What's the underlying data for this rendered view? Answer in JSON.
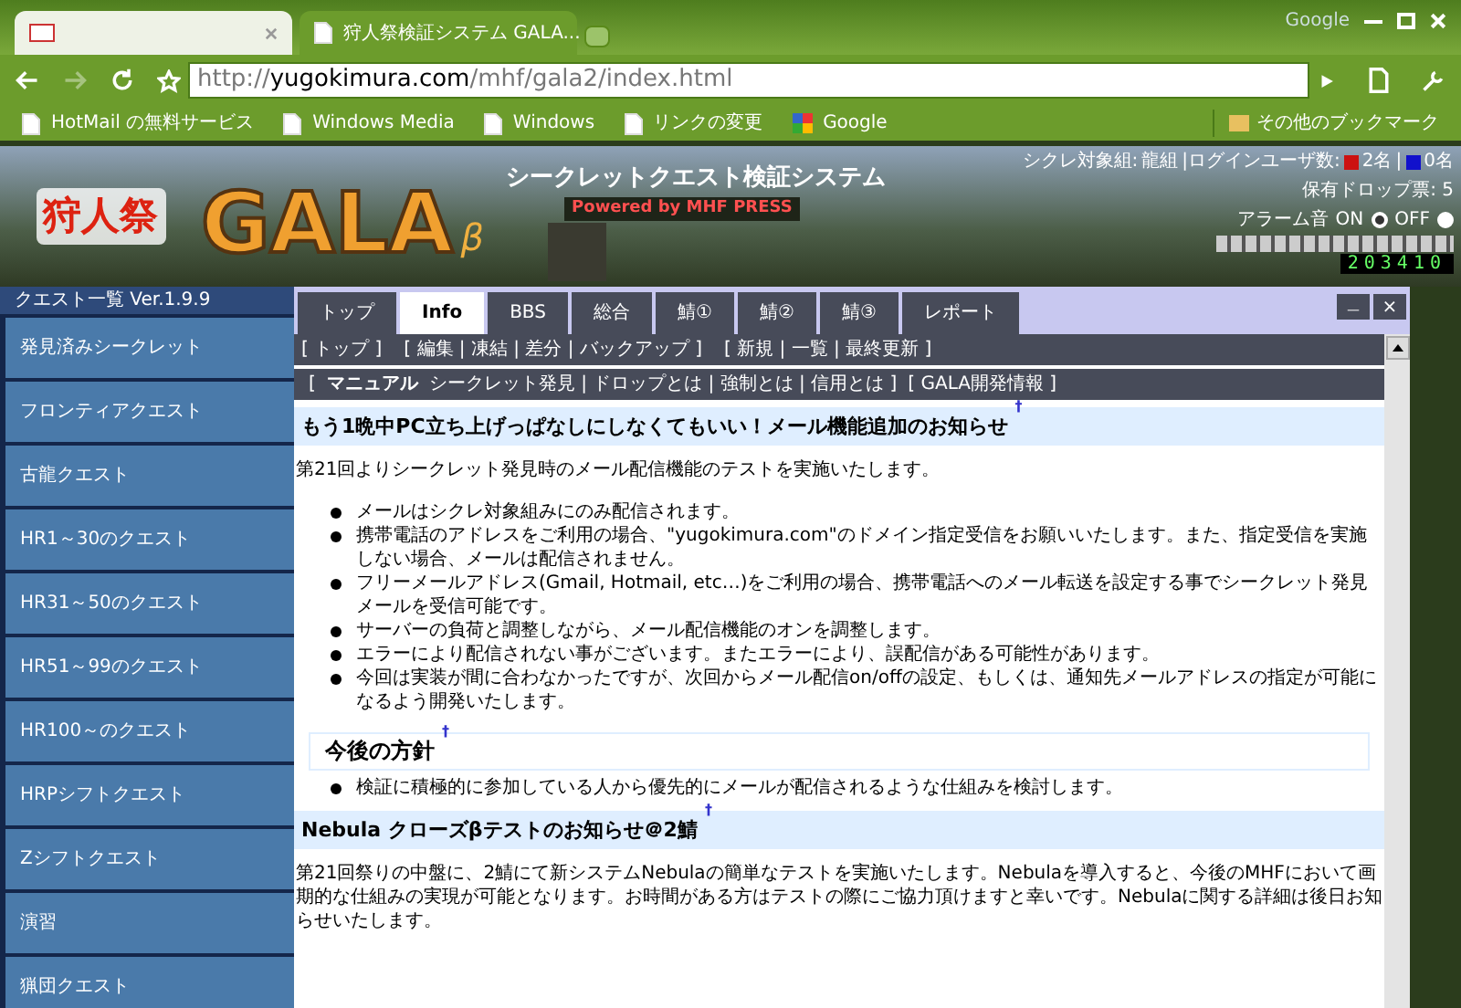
{
  "browser": {
    "tabs": [
      {
        "kind": "mail",
        "selected": false
      },
      {
        "title": "狩人祭検証システム GALA...",
        "kind": "page",
        "selected": true
      }
    ],
    "corner_label": "Google",
    "url": {
      "host": "yugokimura.com",
      "prefix": "http://",
      "path": "/mhf/gala2/index.html"
    },
    "bookmarks": [
      {
        "label": "HotMail の無料サービス",
        "kind": "page"
      },
      {
        "label": "Windows Media",
        "kind": "page"
      },
      {
        "label": "Windows",
        "kind": "page"
      },
      {
        "label": "リンクの変更",
        "kind": "page"
      },
      {
        "label": "Google",
        "kind": "google"
      }
    ],
    "other_bookmarks": "その他のブックマーク"
  },
  "banner": {
    "festival": "狩人祭",
    "logo": "GALA",
    "beta": "β",
    "subtitle": "シークレットクエスト検証システム",
    "powered": "Powered by MHF PRESS",
    "status": {
      "target_label": "シクレ対象組:",
      "target": "龍組",
      "users_label": "|ログインユーザ数:",
      "red_count": "2名",
      "separator": "|",
      "blue_count": "0名",
      "drops": "保有ドロップ票: 5"
    },
    "alarm": {
      "label": "アラーム音",
      "options": [
        {
          "label": "ON",
          "selected": true
        },
        {
          "label": "OFF",
          "selected": false
        }
      ]
    },
    "counter": "203410"
  },
  "sidebar": {
    "title": "クエスト一覧 Ver.1.9.9",
    "items": [
      "発見済みシークレット",
      "フロンティアクエスト",
      "古龍クエスト",
      "HR1～30のクエスト",
      "HR31～50のクエスト",
      "HR51～99のクエスト",
      "HR100～のクエスト",
      "HRPシフトクエスト",
      "Zシフトクエスト",
      "演習",
      "猟団クエスト"
    ]
  },
  "panel": {
    "tabs": [
      {
        "label": "トップ",
        "selected": false
      },
      {
        "label": "Info",
        "selected": true
      },
      {
        "label": "BBS",
        "selected": false
      },
      {
        "label": "総合",
        "selected": false
      },
      {
        "label": "鯖①",
        "selected": false
      },
      {
        "label": "鯖②",
        "selected": false
      },
      {
        "label": "鯖③",
        "selected": false
      },
      {
        "label": "レポート",
        "selected": false
      }
    ],
    "minimize": "＿",
    "close": "×",
    "menu": [
      "[ トップ ]",
      "[ 編集 | 凍結 | 差分 | バックアップ ]",
      "[ 新規 | 一覧 | 最終更新 ]"
    ],
    "submenu": [
      {
        "text": "[",
        "bold": false
      },
      {
        "text": "マニュアル",
        "bold": true
      },
      {
        "text": "シークレット発見 | ドロップとは | 強制とは | 信用とは ]",
        "bold": false
      },
      {
        "text": "[ GALA開発情報 ]",
        "bold": false
      }
    ],
    "content": [
      {
        "kind": "h3",
        "text": "もう1晩中PC立ち上げっぱなしにしなくてもいい！メール機能追加のお知らせ",
        "mark": "†"
      },
      {
        "kind": "p",
        "text": "第21回よりシークレット発見時のメール配信機能のテストを実施いたします。"
      },
      {
        "kind": "ul",
        "items": [
          "メールはシクレ対象組みにのみ配信されます。",
          "携帯電話のアドレスをご利用の場合、\"yugokimura.com\"のドメイン指定受信をお願いいたします。また、指定受信を実施しない場合、メールは配信されません。",
          "フリーメールアドレス(Gmail, Hotmail, etc…)をご利用の場合、携帯電話へのメール転送を設定する事でシークレット発見メールを受信可能です。",
          "サーバーの負荷と調整しながら、メール配信機能のオンを調整します。",
          "エラーにより配信されない事がございます。またエラーにより、誤配信がある可能性があります。",
          "今回は実装が間に合わなかったですが、次回からメール配信on/offの設定、もしくは、通知先メールアドレスの指定が可能になるよう開発いたします。"
        ]
      },
      {
        "kind": "h4",
        "text": "今後の方針",
        "mark": "†"
      },
      {
        "kind": "ul",
        "items": [
          "検証に積極的に参加している人から優先的にメールが配信されるような仕組みを検討します。"
        ]
      },
      {
        "kind": "h3",
        "text": "Nebula クローズβテストのお知らせ＠2鯖",
        "mark": "†"
      },
      {
        "kind": "p",
        "text": "第21回祭りの中盤に、2鯖にて新システムNebulaの簡単なテストを実施いたします。Nebulaを導入すると、今後のMHFにおいて画期的な仕組みの実現が可能となります。お時間がある方はテストの際にご協力頂けますと幸いです。Nebulaに関する詳細は後日お知らせいたします。"
      }
    ]
  }
}
